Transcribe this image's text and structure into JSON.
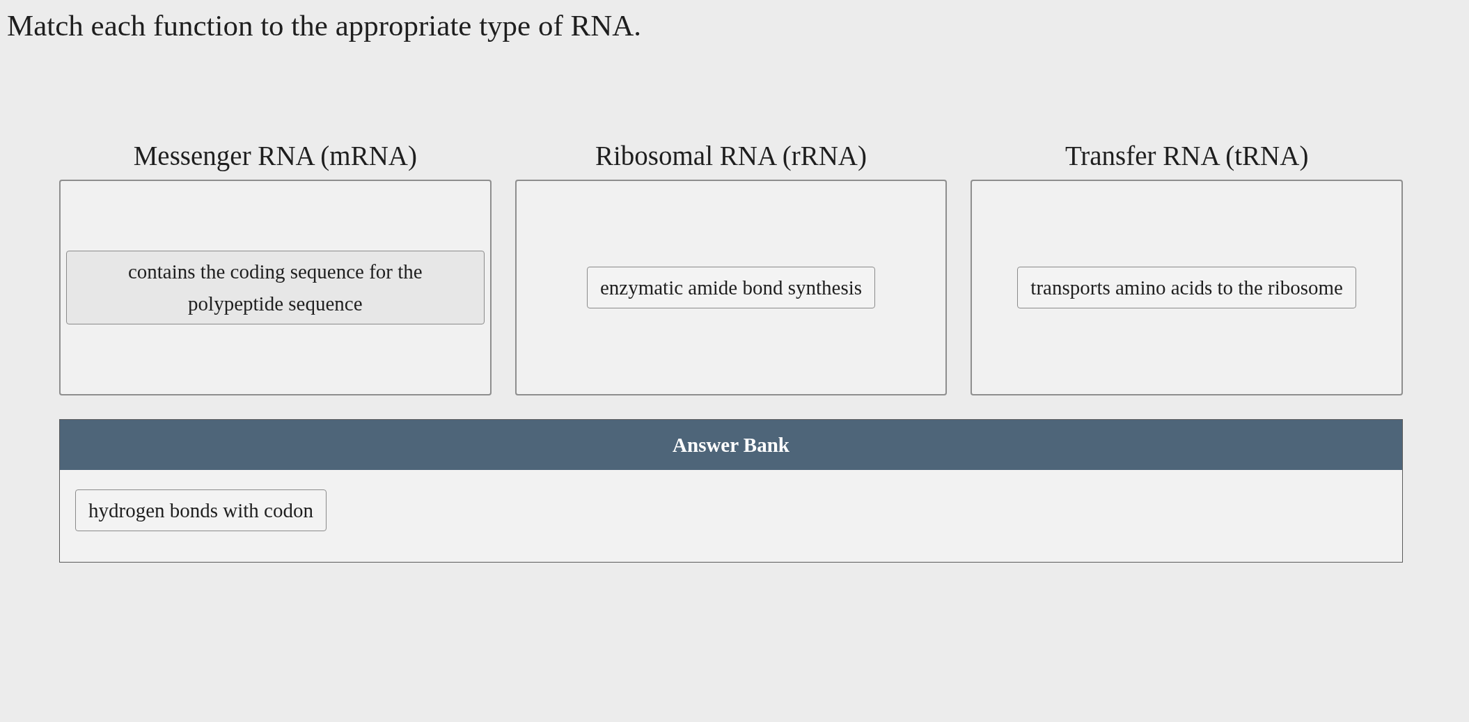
{
  "instruction": "Match each function to the appropriate type of RNA.",
  "targets": [
    {
      "heading": "Messenger RNA (mRNA)",
      "answers": [
        "contains the coding sequence for the polypeptide sequence"
      ]
    },
    {
      "heading": "Ribosomal RNA (rRNA)",
      "answers": [
        "enzymatic amide bond synthesis"
      ]
    },
    {
      "heading": "Transfer RNA (tRNA)",
      "answers": [
        "transports amino acids to the ribosome"
      ]
    }
  ],
  "answer_bank": {
    "title": "Answer Bank",
    "items": [
      "hydrogen bonds with codon"
    ]
  }
}
